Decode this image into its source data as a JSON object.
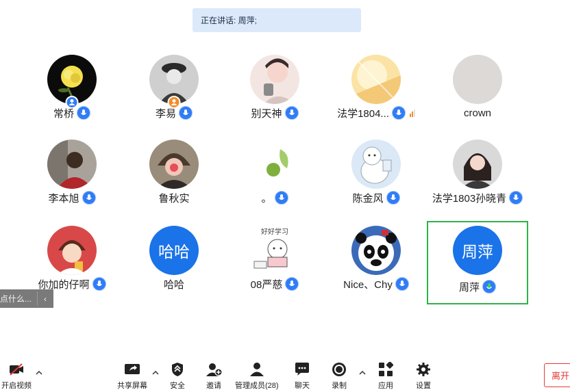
{
  "banner": {
    "text": "正在讲话: 周萍;"
  },
  "participants": [
    {
      "name": "常桥",
      "mic": true,
      "badge": "user",
      "avatar": "rose"
    },
    {
      "name": "李易",
      "mic": true,
      "badge": "user-orange",
      "avatar": "soldier"
    },
    {
      "name": "别天神",
      "mic": true,
      "avatar": "girl-cat"
    },
    {
      "name": "法学1804...",
      "mic": true,
      "signal": true,
      "avatar": "sunlight"
    },
    {
      "name": "crown",
      "mic": false,
      "avatar": "gray"
    },
    {
      "name": "李本旭",
      "mic": true,
      "avatar": "man-red"
    },
    {
      "name": "鲁秋实",
      "mic": false,
      "avatar": "hat-kid"
    },
    {
      "name": "。",
      "mic": true,
      "avatar": "leaf"
    },
    {
      "name": "陈金风",
      "mic": true,
      "avatar": "bear"
    },
    {
      "name": "法学1803孙晓青",
      "mic": true,
      "avatar": "woman"
    },
    {
      "name": "你加的仔啊",
      "mic": true,
      "avatar": "cartoon-boy"
    },
    {
      "name": "哈哈",
      "mic": false,
      "avatar_text": "哈哈",
      "avatar": "text"
    },
    {
      "name": "08严慈",
      "mic": true,
      "avatar": "cat-reading",
      "avatar_caption": "好好学习"
    },
    {
      "name": "Nice、Chy",
      "mic": true,
      "avatar": "panda"
    },
    {
      "name": "周萍",
      "mic": true,
      "speaking": true,
      "active": true,
      "avatar_text": "周萍",
      "avatar": "text"
    }
  ],
  "side_tab": {
    "text": "点什么...",
    "arrow": "‹"
  },
  "toolbar": {
    "video": "开启视频",
    "share": "共享屏幕",
    "security": "安全",
    "invite": "邀请",
    "members": "管理成员(28)",
    "chat": "聊天",
    "record": "录制",
    "apps": "应用",
    "settings": "设置",
    "leave": "离开"
  },
  "colors": {
    "accent": "#1a73e8",
    "speaking_border": "#2bb34a",
    "leave": "#e53935"
  }
}
